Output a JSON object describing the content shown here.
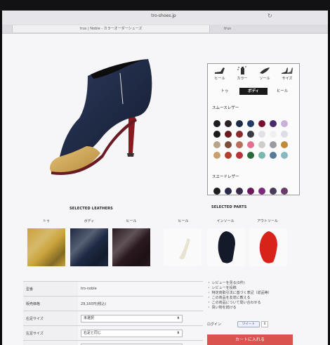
{
  "browser": {
    "url": "tro-shoes.jp",
    "tabs": [
      {
        "label": "trus | Noble - カラーオーダーシューズ",
        "active": true
      },
      {
        "label": "trus",
        "active": false
      }
    ]
  },
  "customizer": {
    "categories": [
      {
        "label": "ヒール",
        "icon": "heel-shoe-icon"
      },
      {
        "label": "カラー",
        "icon": "spray-color-icon"
      },
      {
        "label": "ソール",
        "icon": "sole-icon"
      },
      {
        "label": "サイズ",
        "icon": "size-shoes-icon"
      }
    ],
    "parts": [
      {
        "label": "トゥ",
        "active": false
      },
      {
        "label": "ボディ",
        "active": true
      },
      {
        "label": "ヒール",
        "active": false
      }
    ],
    "smooth_label": "スムースレザー",
    "suede_label": "スエードレザー",
    "smooth_colors": [
      "#1e1e22",
      "#2a2226",
      "#1f2a44",
      "#233a66",
      "#7a1030",
      "#4a2a6a",
      "#c9b2d8",
      "#1c1c1c",
      "#6a1a1c",
      "#8a2a2e",
      "#3a3a44",
      "#e2e2e6",
      "#f0f0f2",
      "#dcdde6",
      "#b9a48a",
      "#7a4e3a",
      "#b86c5a",
      "#e07090",
      "#d0cccc",
      "#9a9aa0",
      "#c08a3a",
      "#c8a070",
      "#b04030",
      "#b8333a",
      "#2a6a3a",
      "#7ab7b0",
      "#5a7a9a",
      "#88b8c0"
    ],
    "suede_colors": [
      "#1e1e22",
      "#2a2a4a",
      "#3a2a4a",
      "#6a1a5a",
      "#7a2a7a",
      "#4a3a5a",
      "#6a3a6a"
    ]
  },
  "selected_leathers": {
    "heading": "SELECTED LEATHERS",
    "items": [
      {
        "label": "トゥ",
        "color": "#c9a23a"
      },
      {
        "label": "ボディ",
        "color": "#1e2a44"
      },
      {
        "label": "ヒール",
        "color": "#2a1a20"
      }
    ]
  },
  "selected_parts": {
    "heading": "SELECTED PARTS",
    "items": [
      {
        "label": "ヒール",
        "color": "#e8e2d0"
      },
      {
        "label": "インソール",
        "color": "#141a2a"
      },
      {
        "label": "アウトソール",
        "color": "#d8231a"
      }
    ]
  },
  "specs": [
    {
      "key": "型番",
      "value": "tro-noble"
    },
    {
      "key": "販売価格",
      "value": "29,160円(税込)"
    },
    {
      "key": "右足サイズ",
      "value": "未選択",
      "select": true
    },
    {
      "key": "左足サイズ",
      "value": "右足と同じ",
      "select": true
    },
    {
      "key": "",
      "value": "",
      "select": true
    }
  ],
  "links": [
    "・ レビューを見る(0件)",
    "・ レビューを投稿",
    "",
    "・ 特定商取引法に基づく表記（返品等）",
    "・ この商品を友達に教える",
    "・ この商品について問い合わせる",
    "・ 買い物を続ける"
  ],
  "login_label": "ログイン",
  "tweet_label": "ツイート",
  "tweet_count": "0",
  "cart_label": "カートに入れる"
}
